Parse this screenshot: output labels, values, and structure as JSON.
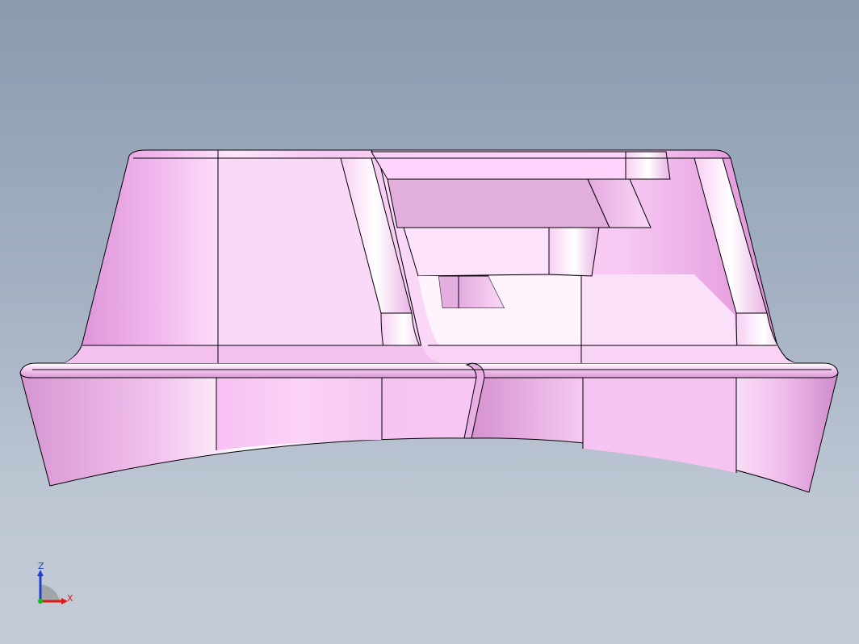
{
  "viewport": {
    "background_top": "#8a9bb0",
    "background_bottom": "#c4ccd7"
  },
  "model": {
    "part_color": "#f7c2f2",
    "highlight_color": "#ffffff",
    "shadow_color": "#d9a0d4",
    "edge_color": "#000000"
  },
  "triad": {
    "z_label": "Z",
    "x_label": "X",
    "z_color": "#1f3fd0",
    "x_color": "#e01818",
    "origin_color": "#10c010"
  }
}
